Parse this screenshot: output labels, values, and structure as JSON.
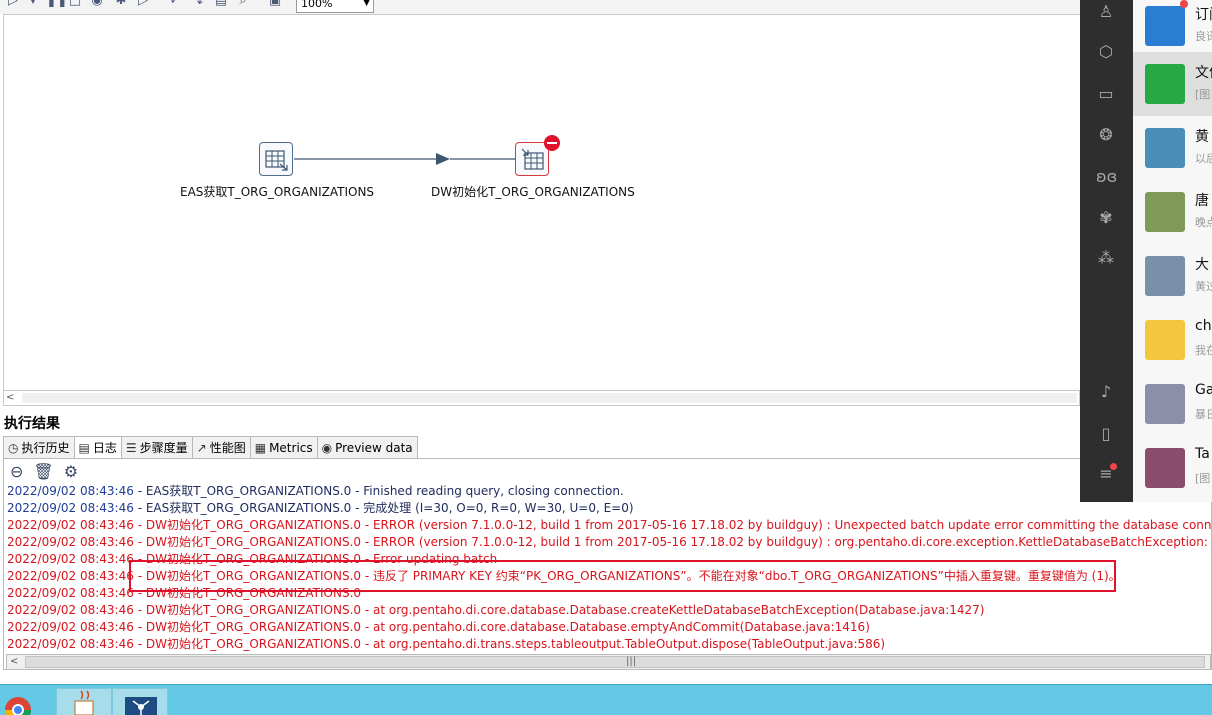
{
  "toolbar": {
    "zoom": "100%",
    "icons": [
      "run-icon",
      "dropdown-icon",
      "pause-icon",
      "stop-icon",
      "preview-icon",
      "debug-icon",
      "replay-icon",
      "verify-icon",
      "impact-icon",
      "sql-icon",
      "explore-db-icon",
      "show-results-icon"
    ]
  },
  "canvas": {
    "steps": [
      {
        "label": "EAS获取T_ORG_ORGANIZATIONS",
        "icon": "table-input-icon",
        "error": false
      },
      {
        "label": "DW初始化T_ORG_ORGANIZATIONS",
        "icon": "table-output-icon",
        "error": true
      }
    ]
  },
  "results": {
    "title": "执行结果",
    "tabs": [
      {
        "label": "执行历史",
        "icon": "history-icon"
      },
      {
        "label": "日志",
        "icon": "log-icon",
        "active": true
      },
      {
        "label": "步骤度量",
        "icon": "step-metrics-icon"
      },
      {
        "label": "性能图",
        "icon": "performance-icon"
      },
      {
        "label": "Metrics",
        "icon": "metrics-icon"
      },
      {
        "label": "Preview data",
        "icon": "preview-data-icon"
      }
    ],
    "log_tools": [
      "stop-log-icon",
      "clear-log-icon",
      "log-settings-icon"
    ],
    "log_lines": [
      {
        "type": "info",
        "ts": "2022/09/02 08:43:46",
        "text": " - EAS获取T_ORG_ORGANIZATIONS.0 - Finished reading query, closing connection."
      },
      {
        "type": "info",
        "ts": "2022/09/02 08:43:46",
        "text": " - EAS获取T_ORG_ORGANIZATIONS.0 - 完成处理 (I=30, O=0, R=0, W=30, U=0, E=0)"
      },
      {
        "type": "error",
        "ts": "2022/09/02 08:43:46",
        "text": " - DW初始化T_ORG_ORGANIZATIONS.0 - ERROR (version 7.1.0.0-12, build 1 from 2017-05-16 17.18.02 by buildguy) : Unexpected batch update error committing the database connection."
      },
      {
        "type": "error",
        "ts": "2022/09/02 08:43:46",
        "text": " - DW初始化T_ORG_ORGANIZATIONS.0 - ERROR (version 7.1.0.0-12, build 1 from 2017-05-16 17.18.02 by buildguy) : org.pentaho.di.core.exception.KettleDatabaseBatchException:"
      },
      {
        "type": "error",
        "ts": "2022/09/02 08:43:46",
        "text": " - DW初始化T_ORG_ORGANIZATIONS.0 - Error updating batch"
      },
      {
        "type": "error",
        "ts": "2022/09/02 08:43:46",
        "text": " - DW初始化T_ORG_ORGANIZATIONS.0 - 违反了 PRIMARY KEY 约束“PK_ORG_ORGANIZATIONS”。不能在对象“dbo.T_ORG_ORGANIZATIONS”中插入重复键。重复键值为 (1)。"
      },
      {
        "type": "error",
        "ts": "2022/09/02 08:43:46",
        "text": " - DW初始化T_ORG_ORGANIZATIONS.0"
      },
      {
        "type": "error",
        "ts": "2022/09/02 08:43:46",
        "text": " - DW初始化T_ORG_ORGANIZATIONS.0 -     at org.pentaho.di.core.database.Database.createKettleDatabaseBatchException(Database.java:1427)"
      },
      {
        "type": "error",
        "ts": "2022/09/02 08:43:46",
        "text": " - DW初始化T_ORG_ORGANIZATIONS.0 -     at org.pentaho.di.core.database.Database.emptyAndCommit(Database.java:1416)"
      },
      {
        "type": "error",
        "ts": "2022/09/02 08:43:46",
        "text": " - DW初始化T_ORG_ORGANIZATIONS.0 -     at org.pentaho.di.trans.steps.tableoutput.TableOutput.dispose(TableOutput.java:586)"
      }
    ]
  },
  "chat_rail": {
    "icons": [
      "contacts-icon",
      "cube-icon",
      "folder-icon",
      "moments-icon",
      "butterfly-icon",
      "gear-flower-icon",
      "spark-icon",
      "music-icon",
      "phone-icon",
      "menu-icon"
    ]
  },
  "chats": [
    {
      "name": "订阅",
      "sub": "良译",
      "avatar_color": "#2b7cd3",
      "unread": true,
      "selected": false
    },
    {
      "name": "文件",
      "sub": "[图",
      "avatar_color": "#27a844",
      "unread": false,
      "selected": true
    },
    {
      "name": "黄",
      "sub": "以后",
      "avatar_color": "#4a8fb8",
      "unread": false,
      "selected": false
    },
    {
      "name": "唐",
      "sub": "晚点",
      "avatar_color": "#7f9a58",
      "unread": false,
      "selected": false
    },
    {
      "name": "大",
      "sub": "黄过",
      "avatar_color": "#7a8fa8",
      "unread": false,
      "selected": false
    },
    {
      "name": "ch",
      "sub": "我在",
      "avatar_color": "#f3c640",
      "unread": false,
      "selected": false
    },
    {
      "name": "Ga",
      "sub": "暴日",
      "avatar_color": "#8c8fa8",
      "unread": false,
      "selected": false
    },
    {
      "name": "Ta",
      "sub": "[图",
      "avatar_color": "#8b4d6e",
      "unread": false,
      "selected": false
    }
  ],
  "taskbar": {
    "apps": [
      "chrome-icon",
      "java-icon",
      "kettle-icon"
    ]
  }
}
